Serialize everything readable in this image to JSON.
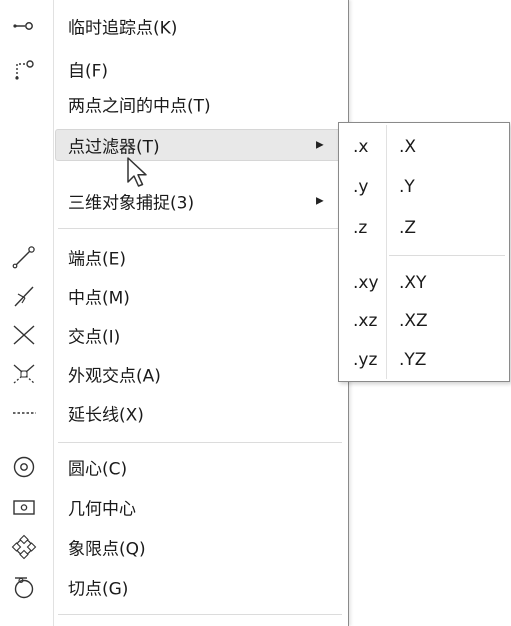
{
  "menu": {
    "items": [
      {
        "icon": "temp-track-point-icon",
        "label": "临时追踪点(K)"
      },
      {
        "icon": "from-icon",
        "label": "自(F)"
      },
      {
        "icon": "",
        "label": "两点之间的中点(T)"
      },
      {
        "icon": "",
        "label": "点过滤器(T)",
        "submenu": true,
        "highlighted": true
      },
      {
        "icon": "",
        "label": "三维对象捕捉(3)",
        "submenu": true
      },
      {
        "icon": "endpoint-icon",
        "label": "端点(E)"
      },
      {
        "icon": "midpoint-icon",
        "label": "中点(M)"
      },
      {
        "icon": "intersection-icon",
        "label": "交点(I)"
      },
      {
        "icon": "apparent-intersection-icon",
        "label": "外观交点(A)"
      },
      {
        "icon": "extension-icon",
        "label": "延长线(X)"
      },
      {
        "icon": "center-icon",
        "label": "圆心(C)"
      },
      {
        "icon": "geometric-center-icon",
        "label": "几何中心"
      },
      {
        "icon": "quadrant-icon",
        "label": "象限点(Q)"
      },
      {
        "icon": "tangent-icon",
        "label": "切点(G)"
      }
    ],
    "arrow_glyph": "▶"
  },
  "submenu": {
    "items": [
      {
        "lower": ".x",
        "upper": ".X"
      },
      {
        "lower": ".y",
        "upper": ".Y"
      },
      {
        "lower": ".z",
        "upper": ".Z"
      },
      {
        "lower": ".xy",
        "upper": ".XY"
      },
      {
        "lower": ".xz",
        "upper": ".XZ"
      },
      {
        "lower": ".yz",
        "upper": ".YZ"
      }
    ]
  },
  "colors": {
    "highlight": "#e8e8e8",
    "separator": "#dcdcdc",
    "border": "#8a8a8a"
  }
}
